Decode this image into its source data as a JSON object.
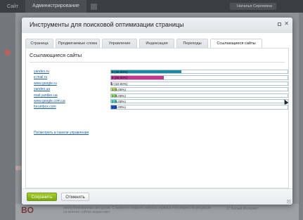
{
  "background": {
    "top_tabs": [
      "Сайт",
      "Администрирование"
    ],
    "badge_count": "0",
    "user_name": "Наталья Сергеевна",
    "bottom_text": "неопубликованных ресурсов. С момента первого запуска сервиса популярности ресурсов на многих сайтах вырастают",
    "bottom_right": "17 Белый Интернет"
  },
  "dialog": {
    "title": "Инструменты для поисковой оптимизации страницы",
    "tabs": [
      {
        "label": "Страница",
        "active": false
      },
      {
        "label": "Продвигаемые слова",
        "active": false
      },
      {
        "label": "Управление",
        "active": false
      },
      {
        "label": "Индексация",
        "active": false
      },
      {
        "label": "Переходы",
        "active": false
      },
      {
        "label": "Ссылающиеся сайты",
        "active": true
      }
    ],
    "section_title": "Ссылающиеся сайты",
    "sites": [
      {
        "name": "yandex.ru",
        "count": "9",
        "pct": 40,
        "label": "9 (40.00%)",
        "color": "#1a8aa1"
      },
      {
        "name": "e.mail.ru",
        "count": "8",
        "pct": 30,
        "label": "8 (30.00%)",
        "color": "#c8358f"
      },
      {
        "name": "www.google.ru",
        "count": "2",
        "pct": 0.5,
        "label": "2 (10.00%)",
        "color": "#8a2b4a"
      },
      {
        "name": "yandex.ua",
        "count": "1",
        "pct": 3,
        "label": "1 (5.00%)",
        "color": "#c7dc5c"
      },
      {
        "name": "mail.yandex.ua",
        "count": "1",
        "pct": 3,
        "label": "1 (5.00%)",
        "color": "#9fde7c"
      },
      {
        "name": "www.google.com.ua",
        "count": "1",
        "pct": 3,
        "label": "1 (5.00%)",
        "color": "#5fd8d0"
      },
      {
        "name": "forumbox.com",
        "count": "1",
        "pct": 3,
        "label": "1 (5.00%)",
        "color": "#1f56c4"
      }
    ],
    "manage_link": "Посмотреть в панели управления",
    "save_label": "Сохранить",
    "cancel_label": "Отменить"
  }
}
